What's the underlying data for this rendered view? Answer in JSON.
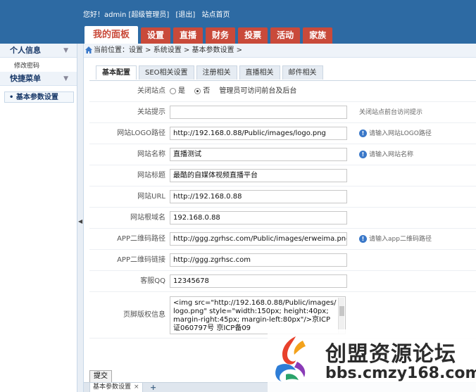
{
  "header": {
    "greeting": "您好！admin [超级管理员]",
    "logout": "[退出]",
    "site_home": "站点首页",
    "nav_tabs": [
      "我的面板",
      "设置",
      "直播",
      "财务",
      "投票",
      "活动",
      "家族"
    ],
    "accent_color": "#2d6aa3",
    "tab_color": "#c94a3a"
  },
  "sidebar": {
    "section1": "个人信息",
    "link1": "修改密码",
    "section2": "快捷菜单",
    "item1": "• 基本参数设置",
    "chevron_icon": "chevron-down-icon"
  },
  "breadcrumb": {
    "text": "当前位置：设置 > 系统设置 > 基本参数设置 >",
    "icon": "home-icon"
  },
  "tabs": [
    "基本配置",
    "SEO相关设置",
    "注册相关",
    "直播相关",
    "邮件相关"
  ],
  "form": {
    "close_site": {
      "label": "关闭站点",
      "opt_yes": "是",
      "opt_no": "否",
      "selected": "否",
      "hint": "管理员可访问前台及后台"
    },
    "close_notice": {
      "label": "关站提示",
      "value": "",
      "hint": "关闭站点前台访问提示"
    },
    "logo_path": {
      "label": "网站LOGO路径",
      "value": "http://192.168.0.88/Public/images/logo.png",
      "hint": "请输入网站LOGO路径"
    },
    "site_name": {
      "label": "网站名称",
      "value": "直播测试",
      "hint": "请输入网站名称"
    },
    "site_title": {
      "label": "网站标题",
      "value": "最酷的自媒体视频直播平台"
    },
    "site_url": {
      "label": "网站URL",
      "value": "http://192.168.0.88"
    },
    "site_domain": {
      "label": "网站根域名",
      "value": "192.168.0.88"
    },
    "app_qr_path": {
      "label": "APP二维码路径",
      "value": "http://ggg.zgrhsc.com/Public/images/erweima.png",
      "hint": "请输入app二维码路径"
    },
    "app_qr_link": {
      "label": "APP二维码链接",
      "value": "http://ggg.zgrhsc.com"
    },
    "service_qq": {
      "label": "客服QQ",
      "value": "12345678"
    },
    "footer_copyright": {
      "label": "页脚版权信息",
      "value": "<img src=\"http://192.168.0.88/Public/images/logo.png\" style=\"width:150px; height:40px; margin-right:45px; margin-left:80px\"/>京ICP证060797号 京ICP备09"
    }
  },
  "submit_label": "提交",
  "bottom_tab": {
    "label": "基本参数设置",
    "close": "×",
    "add": "+"
  },
  "watermark": {
    "title": "创盟资源论坛",
    "url": "bbs.cmzy168.com"
  }
}
